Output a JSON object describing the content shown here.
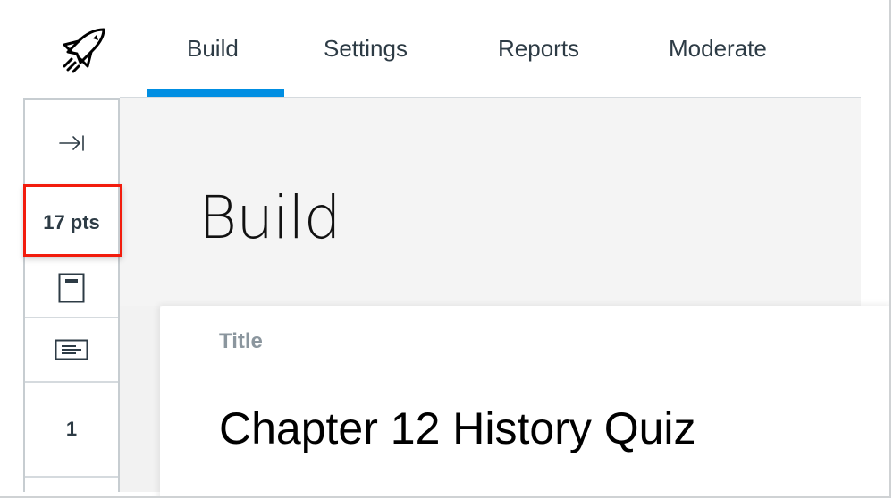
{
  "header": {
    "logo_icon": "rocket-icon",
    "tabs": [
      {
        "label": "Build",
        "active": true
      },
      {
        "label": "Settings",
        "active": false
      },
      {
        "label": "Reports",
        "active": false
      },
      {
        "label": "Moderate",
        "active": false
      }
    ],
    "active_color": "#008ee2"
  },
  "sidebar": {
    "collapse_icon": "expand-right-icon",
    "points": "17 pts",
    "items": [
      {
        "icon": "page-icon"
      },
      {
        "icon": "text-block-icon"
      },
      {
        "label": "1"
      }
    ]
  },
  "annotation": {
    "color": "#f21c0d",
    "target": "points"
  },
  "main": {
    "page_title": "Build",
    "card": {
      "label": "Title",
      "value": "Chapter 12 History Quiz"
    }
  }
}
